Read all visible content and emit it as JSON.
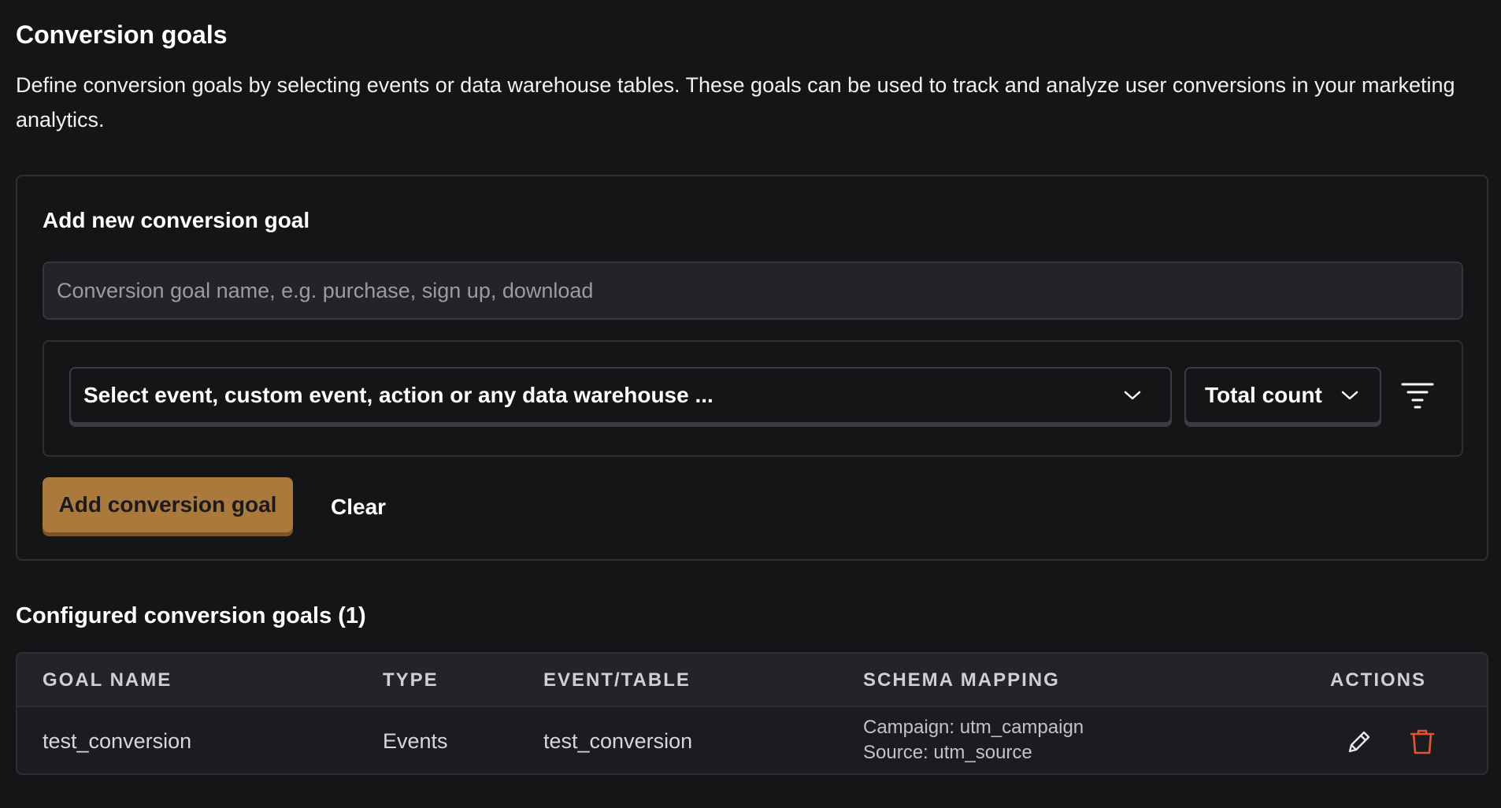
{
  "page": {
    "title": "Conversion goals",
    "description": "Define conversion goals by selecting events or data warehouse tables. These goals can be used to track and analyze user conversions in your marketing analytics."
  },
  "add_form": {
    "title": "Add new conversion goal",
    "name_placeholder": "Conversion goal name, e.g. purchase, sign up, download",
    "name_value": "",
    "event_select_label": "Select event, custom event, action or any data warehouse ...",
    "math_select_label": "Total count",
    "add_button_label": "Add conversion goal",
    "clear_button_label": "Clear",
    "icons": {
      "event_chevron": "chevron-down-icon",
      "math_chevron": "chevron-down-icon",
      "filter": "filter-icon"
    }
  },
  "configured": {
    "title": "Configured conversion goals (1)",
    "columns": [
      "GOAL NAME",
      "TYPE",
      "EVENT/TABLE",
      "SCHEMA MAPPING",
      "ACTIONS"
    ],
    "rows": [
      {
        "goal_name": "test_conversion",
        "type": "Events",
        "event_table": "test_conversion",
        "mapping_campaign": "Campaign: utm_campaign",
        "mapping_source": "Source: utm_source",
        "actions": [
          "edit-icon",
          "trash-icon"
        ]
      }
    ]
  },
  "colors": {
    "background": "#141517",
    "primary_button": "#aa7a3d",
    "delete_icon": "#e8542a",
    "border": "#2d2f33"
  }
}
